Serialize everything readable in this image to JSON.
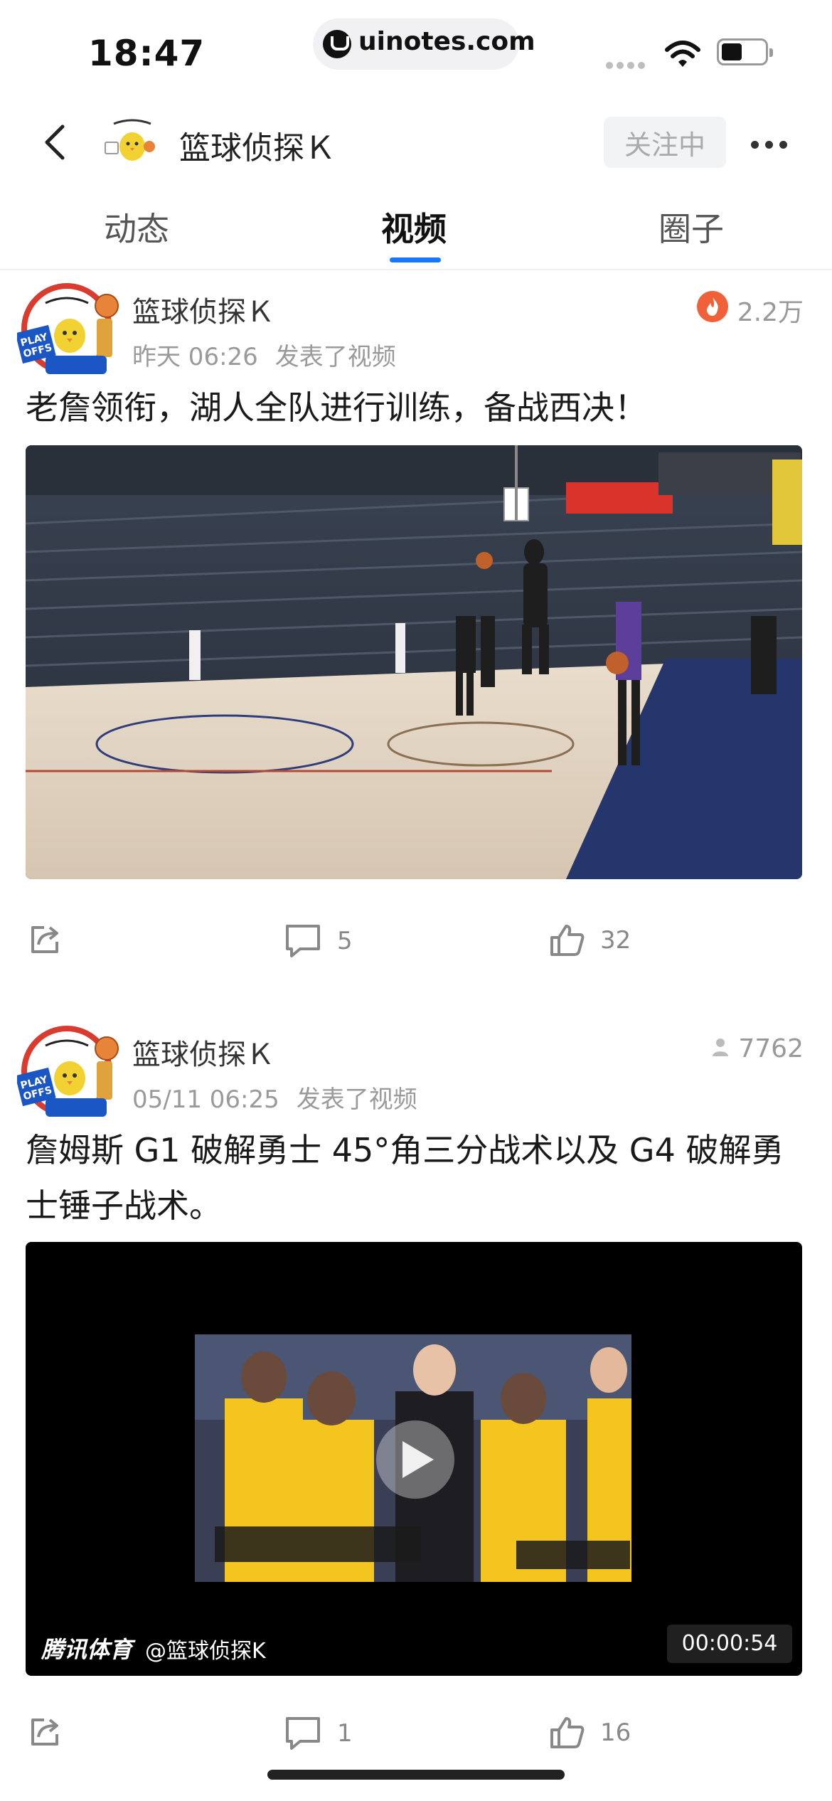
{
  "status_bar": {
    "time": "18:47",
    "url": "uinotes.com"
  },
  "header": {
    "back_icon": "chevron-left-icon",
    "title": "篮球侦探Ｋ",
    "follow_label": "关注中",
    "more_icon": "more-horizontal-icon"
  },
  "tabs": [
    {
      "label": "动态",
      "active": false
    },
    {
      "label": "视频",
      "active": true
    },
    {
      "label": "圈子",
      "active": false
    }
  ],
  "accent_color": "#1677ff",
  "posts": [
    {
      "author": "篮球侦探Ｋ",
      "time": "昨天 06:26",
      "action": "发表了视频",
      "metric_icon": "fire-icon",
      "metric": "2.2万",
      "text": "老詹领衔，湖人全队进行训练，备战西决！",
      "media_type": "image",
      "share_icon": "share-icon",
      "comments": "5",
      "likes": "32"
    },
    {
      "author": "篮球侦探Ｋ",
      "time": "05/11 06:25",
      "action": "发表了视频",
      "metric_icon": "person-icon",
      "metric": "7762",
      "text": "詹姆斯 G1 破解勇士 45°角三分战术以及 G4 破解勇士锤子战术。",
      "media_type": "video",
      "watermark_brand": "腾讯体育",
      "watermark_user": "@篮球侦探K",
      "duration": "00:00:54",
      "share_icon": "share-icon",
      "comments": "1",
      "likes": "16"
    }
  ]
}
